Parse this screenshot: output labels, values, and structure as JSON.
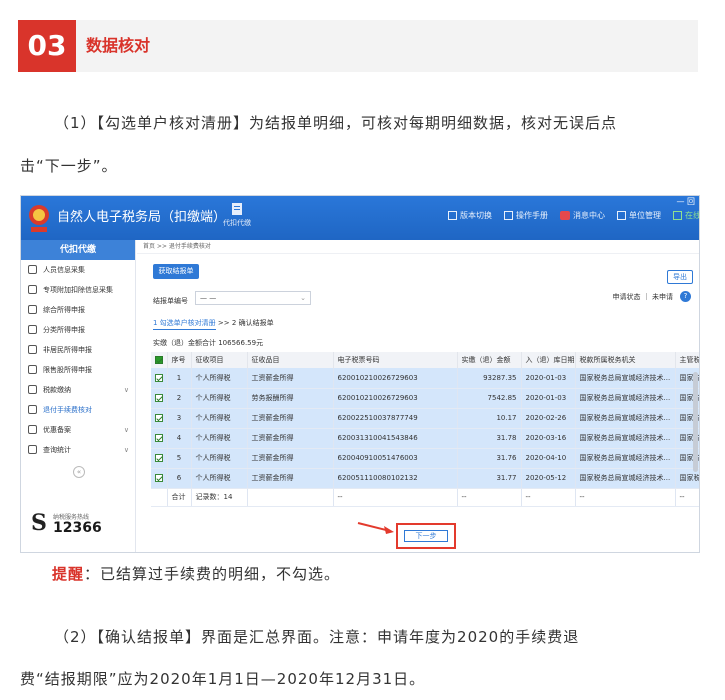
{
  "section": {
    "number": "03",
    "title": "数据核对"
  },
  "para1": {
    "line1": "（1）【勾选单户核对清册】为结报单明细，可核对每期明细数据，核对无误后点",
    "line2": "击“下一步”。"
  },
  "app": {
    "title": "自然人电子税务局（扣缴端）",
    "deputy_label": "代扣代缴",
    "tools": [
      "版本切换",
      "操作手册",
      "消息中心",
      "单位管理",
      "在线"
    ],
    "window_controls": "— 回"
  },
  "sidebar": {
    "header": "代扣代缴",
    "items": [
      {
        "label": "人员信息采集",
        "icon": "person-icon"
      },
      {
        "label": "专项附加扣除信息采集",
        "icon": "list-icon"
      },
      {
        "label": "综合所得申报",
        "icon": "layers-icon"
      },
      {
        "label": "分类所得申报",
        "icon": "clock-icon"
      },
      {
        "label": "非居民所得申报",
        "icon": "person-icon"
      },
      {
        "label": "限售股所得申报",
        "icon": "bar-chart-icon"
      },
      {
        "label": "税款缴纳",
        "icon": "wallet-icon",
        "chev": "∨"
      },
      {
        "label": "退付手续费核对",
        "icon": "doc-icon",
        "active": true
      },
      {
        "label": "优惠备案",
        "icon": "doc-icon",
        "chev": "∨"
      },
      {
        "label": "查询统计",
        "icon": "search-icon",
        "chev": "∨"
      }
    ],
    "collapse": "«",
    "hotline_caption": "纳税服务热线",
    "hotline_number": "12366"
  },
  "main": {
    "breadcrumb": "首页 >> 退付手续费核对",
    "get_statement_button": "获取结报单",
    "export_button": "导出",
    "batch_label": "结报单编号",
    "batch_value": "— —",
    "apply_status": "申请状态 ｜ 未申请",
    "step1": "1 勾选单户核对清册",
    "step_sep": ">>",
    "step2": "2 确认结报单",
    "sum_text": "实缴（退）金额合计  106566.59元",
    "columns": [
      "序号",
      "征收项目",
      "征收品目",
      "电子税票号码",
      "实缴（退）金额",
      "入（退）库日期",
      "税款所属税务机关",
      "主管税务所（科）"
    ],
    "rows": [
      [
        "1",
        "个人所得税",
        "工资薪金所得",
        "620010210026729603",
        "93287.35",
        "2020-01-03",
        "国家税务总局宣城经济技术...",
        "国家税务总局宣城"
      ],
      [
        "2",
        "个人所得税",
        "劳务报酬所得",
        "620010210026729603",
        "7542.85",
        "2020-01-03",
        "国家税务总局宣城经济技术...",
        "国家税务总局宣城"
      ],
      [
        "3",
        "个人所得税",
        "工资薪金所得",
        "620022510037877749",
        "10.17",
        "2020-02-26",
        "国家税务总局宣城经济技术...",
        "国家税务总局宣城"
      ],
      [
        "4",
        "个人所得税",
        "工资薪金所得",
        "620031310041543846",
        "31.78",
        "2020-03-16",
        "国家税务总局宣城经济技术...",
        "国家税务总局宣城"
      ],
      [
        "5",
        "个人所得税",
        "工资薪金所得",
        "620040910051476003",
        "31.76",
        "2020-04-10",
        "国家税务总局宣城经济技术...",
        "国家税务总局宣城"
      ],
      [
        "6",
        "个人所得税",
        "工资薪金所得",
        "620051110080102132",
        "31.77",
        "2020-05-12",
        "国家税务总局宣城经济技术...",
        "国家税务总局宣城"
      ]
    ],
    "footer_total": "合计",
    "footer_count": "记录数：14",
    "footer_dash": "--",
    "next_button": "下一步"
  },
  "tip": {
    "label": "提醒",
    "text": "：已结算过手续费的明细，不勾选。"
  },
  "para2": {
    "line1": "（2）【确认结报单】界面是汇总界面。注意：申请年度为2020的手续费退",
    "line2": "费“结报期限”应为2020年1月1日—2020年12月31日。"
  },
  "colors": {
    "accent_red": "#d9342b",
    "app_blue": "#2a77d9",
    "row_selected": "#d4e6fb"
  }
}
